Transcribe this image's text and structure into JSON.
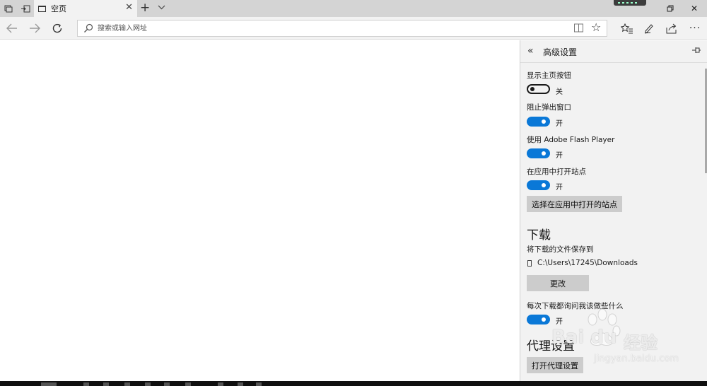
{
  "tab": {
    "title": "空页"
  },
  "address": {
    "placeholder": "搜索或输入网址"
  },
  "panel": {
    "title": "高级设置",
    "settings": [
      {
        "label": "显示主页按钮",
        "state": "关",
        "on": false
      },
      {
        "label": "阻止弹出窗口",
        "state": "开",
        "on": true
      },
      {
        "label": "使用 Adobe Flash Player",
        "state": "开",
        "on": true
      },
      {
        "label": "在应用中打开站点",
        "state": "开",
        "on": true
      }
    ],
    "choose_sites_button": "选择在应用中打开的站点",
    "download": {
      "heading": "下载",
      "save_label": "将下载的文件保存到",
      "path": "C:\\Users\\17245\\Downloads",
      "change_button": "更改",
      "ask_label": "每次下载都询问我该做些什么",
      "ask_state": "开"
    },
    "proxy": {
      "heading": "代理设置",
      "open_button": "打开代理设置"
    }
  },
  "watermark": {
    "brand": "Bai du",
    "brand_cn": "经验",
    "url": "jingyan.baidu.com"
  },
  "colors": {
    "accent": "#0a78d7",
    "panel_bg": "#f2f2f2",
    "tabbar_bg": "#d4d4d4"
  }
}
